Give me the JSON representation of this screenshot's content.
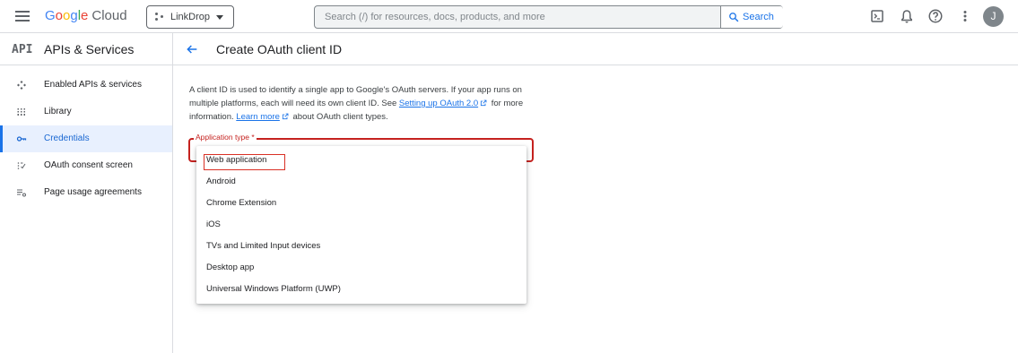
{
  "header": {
    "logo_letters": [
      "G",
      "o",
      "o",
      "g",
      "l",
      "e"
    ],
    "logo_product": "Cloud",
    "project_name": "LinkDrop",
    "search_placeholder": "Search (/) for resources, docs, products, and more",
    "search_button": "Search",
    "avatar_initial": "J",
    "icons": [
      "hamburger-menu-icon",
      "terminal-icon",
      "bell-icon",
      "help-icon",
      "more-vert-icon"
    ]
  },
  "sidebar": {
    "api_logo": "API",
    "title": "APIs & Services",
    "items": [
      {
        "label": "Enabled APIs & services",
        "icon": "enabled-apis-icon",
        "active": false
      },
      {
        "label": "Library",
        "icon": "library-icon",
        "active": false
      },
      {
        "label": "Credentials",
        "icon": "key-icon",
        "active": true
      },
      {
        "label": "OAuth consent screen",
        "icon": "consent-icon",
        "active": false
      },
      {
        "label": "Page usage agreements",
        "icon": "settings-list-icon",
        "active": false
      }
    ]
  },
  "main": {
    "title": "Create OAuth client ID",
    "description": {
      "part1": "A client ID is used to identify a single app to Google's OAuth servers. If your app runs on multiple platforms, each will need its own client ID. See ",
      "link1": "Setting up OAuth 2.0",
      "part2": " for more information. ",
      "link2": "Learn more",
      "part3": " about OAuth client types."
    },
    "field_label": "Application type *",
    "options": [
      "Web application",
      "Android",
      "Chrome Extension",
      "iOS",
      "TVs and Limited Input devices",
      "Desktop app",
      "Universal Windows Platform (UWP)"
    ],
    "highlighted_option": "Web application"
  },
  "colors": {
    "accent": "#1a73e8",
    "error": "#c5221f",
    "active_bg": "#e8f0fe"
  }
}
